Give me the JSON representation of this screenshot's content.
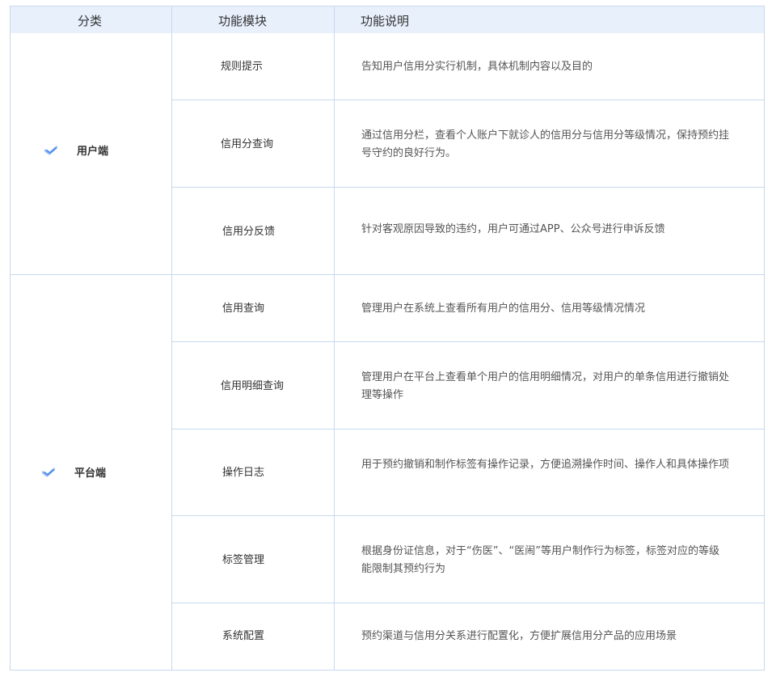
{
  "header": {
    "col_category": "分类",
    "col_module": "功能模块",
    "col_description": "功能说明"
  },
  "categories": [
    {
      "label": "用户端",
      "icon": "check-icon"
    },
    {
      "label": "平台端",
      "icon": "check-icon"
    }
  ],
  "rows": [
    {
      "module": "规则提示",
      "description": "告知用户信用分实行机制，具体机制内容以及目的"
    },
    {
      "module": "信用分查询",
      "description": "通过信用分栏，查看个人账户下就诊人的信用分与信用分等级情况，保持预约挂号守约的良好行为。"
    },
    {
      "module": "信用分反馈",
      "description": "针对客观原因导致的违约，用户可通过APP、公众号进行申诉反馈"
    },
    {
      "module": "信用查询",
      "description": "管理用户在系统上查看所有用户的信用分、信用等级情况情况"
    },
    {
      "module": "信用明细查询",
      "description": "管理用户在平台上查看单个用户的信用明细情况，对用户的单条信用进行撤销处理等操作"
    },
    {
      "module": "操作日志",
      "description": "用于预约撤销和制作标签有操作记录，方便追溯操作时间、操作人和具体操作项"
    },
    {
      "module": "标签管理",
      "description": "根据身份证信息，对于“伤医”、“医闹”等用户制作行为标签，标签对应的等级能限制其预约行为"
    },
    {
      "module": "系统配置",
      "description": "预约渠道与信用分关系进行配置化，方便扩展信用分产品的应用场景"
    }
  ],
  "colors": {
    "header_bg": "#e8f0fc",
    "border": "#c7d9ee",
    "check": "#4d8ff0"
  }
}
